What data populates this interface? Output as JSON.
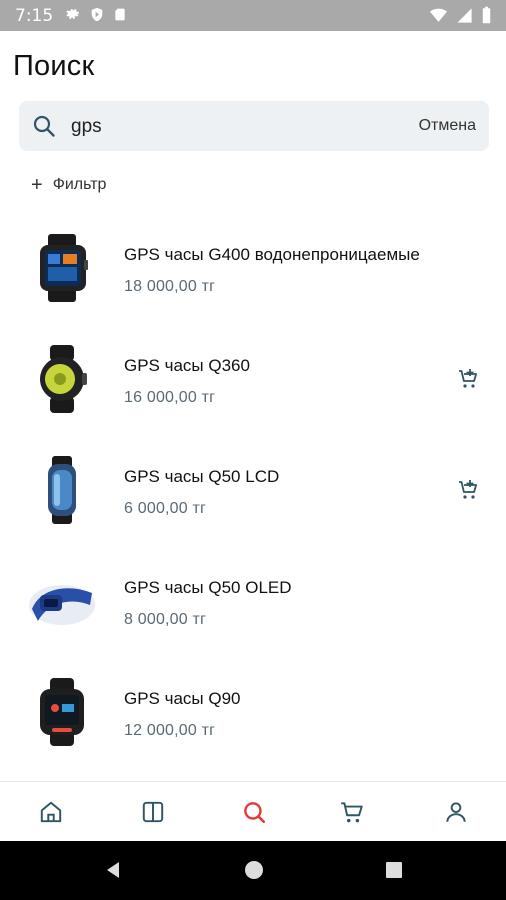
{
  "status_bar": {
    "time": "7:15"
  },
  "page": {
    "title": "Поиск"
  },
  "search": {
    "query": "gps",
    "cancel_label": "Отмена"
  },
  "filter": {
    "label": "Фильтр"
  },
  "results": [
    {
      "name": "GPS часы G400 водонепроницаемые",
      "price": "18 000,00 тг",
      "has_cart_button": false
    },
    {
      "name": "GPS часы Q360",
      "price": "16 000,00 тг",
      "has_cart_button": true
    },
    {
      "name": "GPS часы Q50 LCD",
      "price": "6 000,00 тг",
      "has_cart_button": true
    },
    {
      "name": "GPS часы Q50 OLED",
      "price": "8 000,00 тг",
      "has_cart_button": false
    },
    {
      "name": "GPS часы Q90",
      "price": "12 000,00 тг",
      "has_cart_button": false
    }
  ],
  "bottom_nav": {
    "items": [
      {
        "icon": "home-icon",
        "active": false
      },
      {
        "icon": "catalog-icon",
        "active": false
      },
      {
        "icon": "search-icon",
        "active": true
      },
      {
        "icon": "cart-icon",
        "active": false
      },
      {
        "icon": "profile-icon",
        "active": false
      }
    ],
    "active_color": "#e53935",
    "inactive_color": "#2f5566"
  },
  "colors": {
    "accent": "#e53935",
    "icon": "#2f5566",
    "price": "#5a6a74"
  }
}
